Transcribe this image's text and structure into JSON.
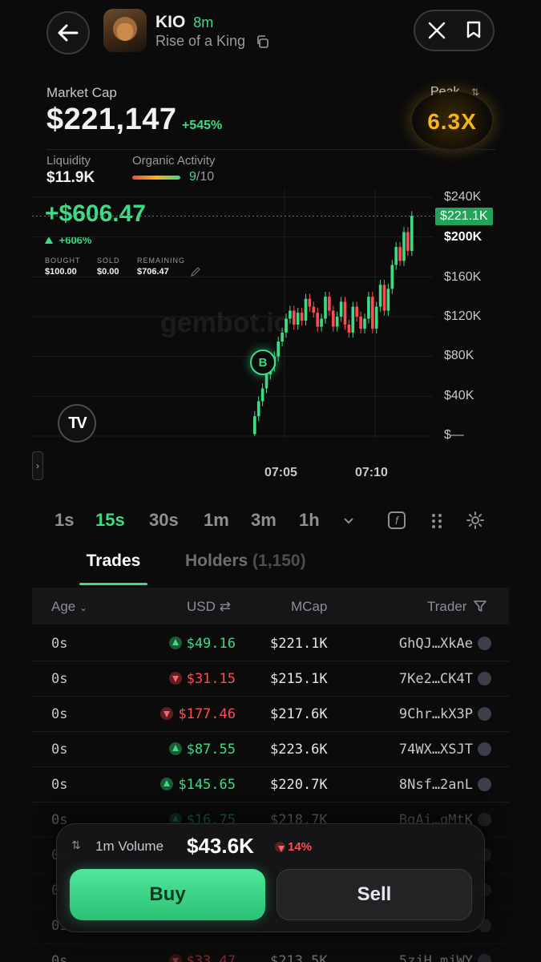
{
  "header": {
    "token_symbol": "KIO",
    "age": "8m",
    "token_name": "Rise of a King"
  },
  "market": {
    "cap_label": "Market Cap",
    "cap_value": "$221,147",
    "cap_change": "+545%",
    "peak_label": "Peak",
    "peak_value": "6.3X",
    "liquidity_label": "Liquidity",
    "liquidity_value": "$11.9K",
    "organic_label": "Organic Activity",
    "organic_score": "9",
    "organic_max": "/10",
    "organic_level": 0.9
  },
  "position": {
    "pnl": "+$606.47",
    "pnl_pct": "+606%",
    "bought_label": "BOUGHT",
    "bought_value": "$100.00",
    "sold_label": "SOLD",
    "sold_value": "$0.00",
    "remaining_label": "REMAINING",
    "remaining_value": "$706.47"
  },
  "chart": {
    "watermark": "gembot.io",
    "price_tag": "$221.1K",
    "y_labels": [
      "$240K",
      "$200K",
      "$160K",
      "$120K",
      "$80K",
      "$40K",
      "$—"
    ],
    "x_labels": [
      "07:05",
      "07:10"
    ],
    "buy_marker": "B",
    "logo": "TV"
  },
  "chart_data": {
    "type": "candlestick",
    "ylim": [
      0,
      240000
    ],
    "y_ticks": [
      "$240K",
      "$200K",
      "$160K",
      "$120K",
      "$80K",
      "$40K",
      "$—"
    ],
    "x_ticks": [
      "07:05",
      "07:10"
    ],
    "current": 221100,
    "candles": [
      [
        2000,
        20000
      ],
      [
        20000,
        35000
      ],
      [
        35000,
        48000
      ],
      [
        48000,
        62000
      ],
      [
        62000,
        70000
      ],
      [
        70000,
        80000
      ],
      [
        80000,
        95000
      ],
      [
        95000,
        104000
      ],
      [
        104000,
        118000
      ],
      [
        118000,
        126000
      ],
      [
        126000,
        112000
      ],
      [
        112000,
        124000
      ],
      [
        124000,
        116000
      ],
      [
        116000,
        138000
      ],
      [
        138000,
        130000
      ],
      [
        130000,
        124000
      ],
      [
        124000,
        110000
      ],
      [
        110000,
        118000
      ],
      [
        118000,
        140000
      ],
      [
        140000,
        126000
      ],
      [
        126000,
        110000
      ],
      [
        110000,
        120000
      ],
      [
        120000,
        135000
      ],
      [
        135000,
        112000
      ],
      [
        112000,
        104000
      ],
      [
        104000,
        130000
      ],
      [
        130000,
        120000
      ],
      [
        120000,
        108000
      ],
      [
        108000,
        118000
      ],
      [
        118000,
        140000
      ],
      [
        140000,
        108000
      ],
      [
        108000,
        130000
      ],
      [
        130000,
        152000
      ],
      [
        152000,
        126000
      ],
      [
        126000,
        148000
      ],
      [
        148000,
        172000
      ],
      [
        172000,
        190000
      ],
      [
        190000,
        176000
      ],
      [
        176000,
        205000
      ],
      [
        205000,
        186000
      ],
      [
        186000,
        221100
      ]
    ]
  },
  "timeframes": [
    "1s",
    "15s",
    "30s",
    "1m",
    "3m",
    "1h"
  ],
  "active_timeframe": "15s",
  "tabs": {
    "trades": "Trades",
    "holders": "Holders",
    "holders_count": "(1,150)"
  },
  "table": {
    "headers": {
      "age": "Age",
      "usd": "USD",
      "mcap": "MCap",
      "trader": "Trader"
    },
    "rows": [
      {
        "age": "0s",
        "usd": "$49.16",
        "dir": "up",
        "mcap": "$221.1K",
        "trader": "GhQJ…XkAe"
      },
      {
        "age": "0s",
        "usd": "$31.15",
        "dir": "down",
        "mcap": "$215.1K",
        "trader": "7Ke2…CK4T"
      },
      {
        "age": "0s",
        "usd": "$177.46",
        "dir": "down",
        "mcap": "$217.6K",
        "trader": "9Chr…kX3P"
      },
      {
        "age": "0s",
        "usd": "$87.55",
        "dir": "up",
        "mcap": "$223.6K",
        "trader": "74WX…XSJT"
      },
      {
        "age": "0s",
        "usd": "$145.65",
        "dir": "up",
        "mcap": "$220.7K",
        "trader": "8Nsf…2anL"
      },
      {
        "age": "0s",
        "usd": "$16.75",
        "dir": "up",
        "mcap": "$218.7K",
        "trader": "BgAi…gMtK"
      },
      {
        "age": "0s",
        "usd": "",
        "dir": "up",
        "mcap": "",
        "trader": ""
      },
      {
        "age": "0s",
        "usd": "",
        "dir": "up",
        "mcap": "",
        "trader": ""
      },
      {
        "age": "0s",
        "usd": "",
        "dir": "up",
        "mcap": "",
        "trader": ""
      },
      {
        "age": "0s",
        "usd": "$33.47",
        "dir": "down",
        "mcap": "$213.5K",
        "trader": "5zjH…mjWY"
      }
    ]
  },
  "trade_panel": {
    "volume_label": "1m Volume",
    "volume_value": "$43.6K",
    "volume_change": "14%",
    "buy_label": "Buy",
    "sell_label": "Sell"
  },
  "colors": {
    "green": "#3ddc84",
    "red": "#ff4d4f",
    "gold": "#f5b21a",
    "bg": "#0b0b0c"
  }
}
